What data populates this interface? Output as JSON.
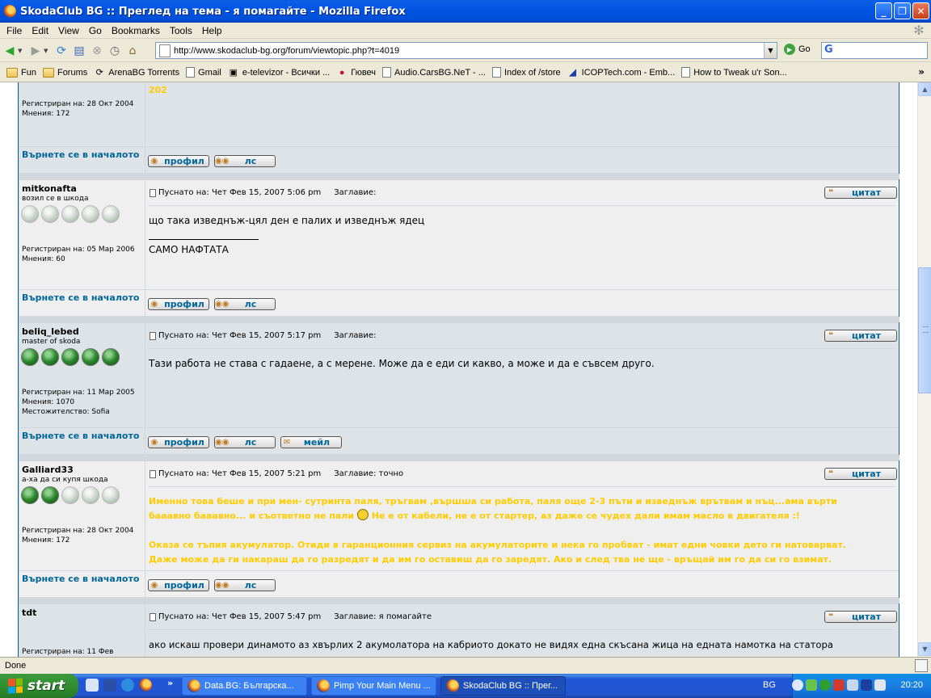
{
  "window": {
    "title": "SkodaClub BG :: Преглед на тема - я помагайте - Mozilla Firefox",
    "minimize": "_",
    "maximize": "❐",
    "close": "✕"
  },
  "menu": [
    "File",
    "Edit",
    "View",
    "Go",
    "Bookmarks",
    "Tools",
    "Help"
  ],
  "nav": {
    "url": "http://www.skodaclub-bg.org/forum/viewtopic.php?t=4019",
    "go_label": "Go"
  },
  "bookmarks": [
    {
      "label": "Fun",
      "icon": "folder-icon"
    },
    {
      "label": "Forums",
      "icon": "folder-icon"
    },
    {
      "label": "ArenaBG Torrents",
      "icon": "arena-icon"
    },
    {
      "label": "Gmail",
      "icon": "page-icon"
    },
    {
      "label": "e-televizor - Всички ...",
      "icon": "tv-icon"
    },
    {
      "label": "Гювеч",
      "icon": "strawberry-icon"
    },
    {
      "label": "Audio.CarsBG.NeT - ...",
      "icon": "page-icon"
    },
    {
      "label": "Index of /store",
      "icon": "page-icon"
    },
    {
      "label": "ICOPTech.com - Emb...",
      "icon": "icop-icon"
    },
    {
      "label": "How to Tweak u'r Son...",
      "icon": "page-icon"
    }
  ],
  "forum": {
    "back_to_top": "Върнете се в началото",
    "btn_profile": "профил",
    "btn_pm": "лс",
    "btn_email": "мейл",
    "btn_quote": "цитат",
    "top_fragment": {
      "text": "202",
      "user_info": [
        "Регистриран на: 28 Окт 2004",
        "Мнения: 172"
      ]
    },
    "posts": [
      {
        "username": "mitkonafta",
        "rank": "возил се в шкода",
        "stars_on": 0,
        "user_info": [
          "Регистриран на: 05 Мар 2006",
          "Мнения: 60"
        ],
        "posted": "Пуснато на: Чет Фев 15, 2007 5:06 pm",
        "subject": "Заглавие:",
        "body": "що така изведнъж-цял ден е палих и изведнъж ядец",
        "signature": "САМО НАФТАТА"
      },
      {
        "username": "beliq_lebed",
        "rank": "master of skoda",
        "stars_on": 5,
        "user_info": [
          "Регистриран на: 11 Мар 2005",
          "Мнения: 1070",
          "Местожителство: Sofia"
        ],
        "posted": "Пуснато на: Чет Фев 15, 2007 5:17 pm",
        "subject": "Заглавие:",
        "body": "Тази работа не става с гадаене, а с мерене. Може да е еди си какво, а може и да е съвсем друго."
      },
      {
        "username": "Galliard33",
        "rank": "а-ха да си купя шкода",
        "stars_on": 2,
        "user_info": [
          "Регистриран на: 28 Окт 2004",
          "Мнения: 172"
        ],
        "posted": "Пуснато на: Чет Фев 15, 2007 5:21 pm",
        "subject": "Заглавие: точно",
        "body_line1": "Именно това беше и при мен- сутринта паля, тръгвам ,вършша си работа, паля още 2-3 пъти и изведнъж врътвам и нъц...ама върти",
        "body_line2a": "бааавно бааавно... и съответно не пали",
        "body_line2b": "Не е от кабели, не е от стартер, аз даже се чудех дали имам масло в двигателя :!",
        "body_line3": "Оказа се тъпия акумулатор. Отиди в гаранционния сервиз на акумулаторите и нека го пробват - имат едни човки дето ги натоварват.",
        "body_line4": "Даже може да ги накараш да го разредят и да им го оставиш да го заредят. Ако и след тва не ще - връщай им го да си го взимат."
      },
      {
        "username": "tdt",
        "user_info": [
          "Регистриран на: 11 Фев"
        ],
        "posted": "Пуснато на: Чет Фев 15, 2007 5:47 pm",
        "subject": "Заглавие: я помагайте",
        "body": "ако искаш провери динамото аз хвърлих 2 акумолатора на кабриото докато не видях една скъсана жица на едната намотка на статора"
      }
    ]
  },
  "status": "Done",
  "taskbar": {
    "start": "start",
    "tasks": [
      "Data.BG: Българска...",
      "Pimp Your Main Menu ...",
      "SkodaClub BG :: Прег..."
    ],
    "lang": "BG",
    "clock": "20:20"
  },
  "colors": {
    "titlebar": "#0054e3",
    "forum_border": "#006699",
    "link": "#006699",
    "row_light": "#efefef",
    "row_dark": "#dee3e7",
    "highlight_text": "#ffcc00"
  }
}
